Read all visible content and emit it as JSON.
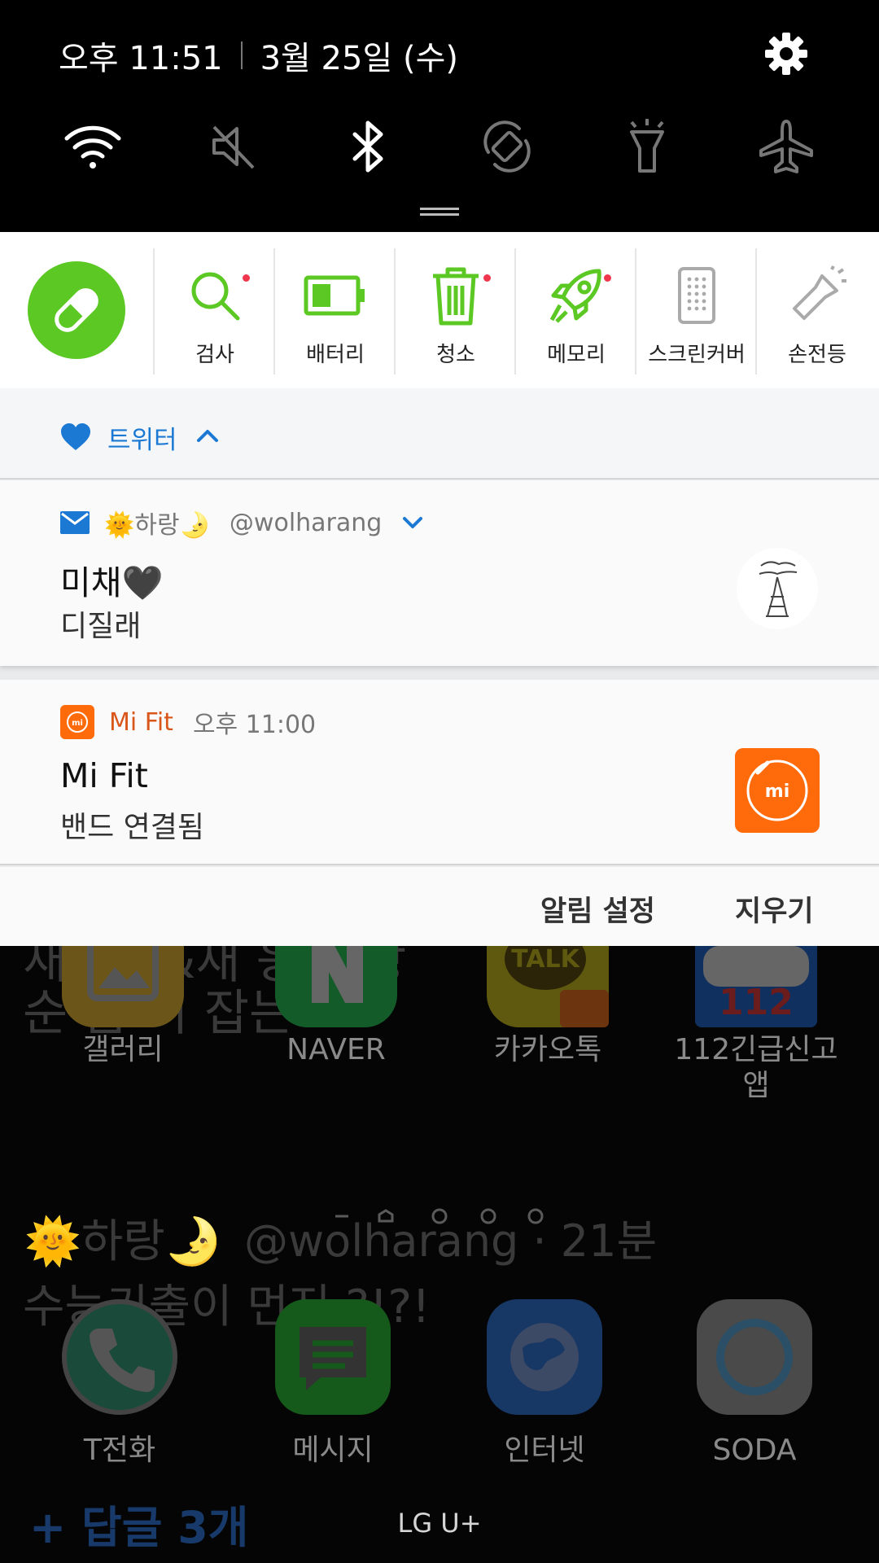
{
  "status": {
    "time": "오후 11:51",
    "date": "3월 25일 (수)"
  },
  "quick_settings": [
    {
      "icon": "wifi-icon",
      "active": true
    },
    {
      "icon": "mute-icon",
      "active": false
    },
    {
      "icon": "bluetooth-icon",
      "active": true
    },
    {
      "icon": "auto-rotate-icon",
      "active": false
    },
    {
      "icon": "flashlight-icon",
      "active": false
    },
    {
      "icon": "airplane-mode-icon",
      "active": false
    }
  ],
  "booster": {
    "accent": "#5cc824",
    "tools": [
      {
        "label": "검사",
        "icon": "search-icon",
        "dot": true
      },
      {
        "label": "배터리",
        "icon": "battery-icon",
        "dot": false
      },
      {
        "label": "청소",
        "icon": "trash-icon",
        "dot": true
      },
      {
        "label": "메모리",
        "icon": "rocket-icon",
        "dot": true
      },
      {
        "label": "스크린커버",
        "icon": "screen-cover-icon",
        "dot": false
      },
      {
        "label": "손전등",
        "icon": "flashlight-icon",
        "dot": false
      }
    ]
  },
  "notifications": {
    "group": {
      "title": "트위터",
      "accent": "#1b79d4"
    },
    "twitter": {
      "sender": "🌞하랑🌛",
      "handle": "@wolharang",
      "title": "미채🖤",
      "body": "디질래"
    },
    "mifit": {
      "app_name": "Mi Fit",
      "time": "오후 11:00",
      "title": "Mi Fit",
      "body": "밴드 연결됨",
      "accent": "#ff6a0a"
    },
    "actions": {
      "settings": "알림 설정",
      "clear": "지우기"
    }
  },
  "home": {
    "bg_line1": "새로운&새 응원 방",
    "bg_line2": "순 좀 이 잡는",
    "bg_tweet_name": "🌞하랑🌛",
    "bg_tweet_handle": "@wolharang · 21분",
    "bg_tweet_text": "수능기출이 먼저 ?!?!",
    "bg_reply": "+ 답글 3개",
    "apps": [
      {
        "label": "갤러리"
      },
      {
        "label": "NAVER"
      },
      {
        "label": "카카오톡"
      },
      {
        "label": "112긴급신고\n앱"
      }
    ],
    "dock": [
      {
        "label": "T전화"
      },
      {
        "label": "메시지"
      },
      {
        "label": "인터넷"
      },
      {
        "label": "SODA"
      }
    ],
    "carrier": "LG U+"
  }
}
